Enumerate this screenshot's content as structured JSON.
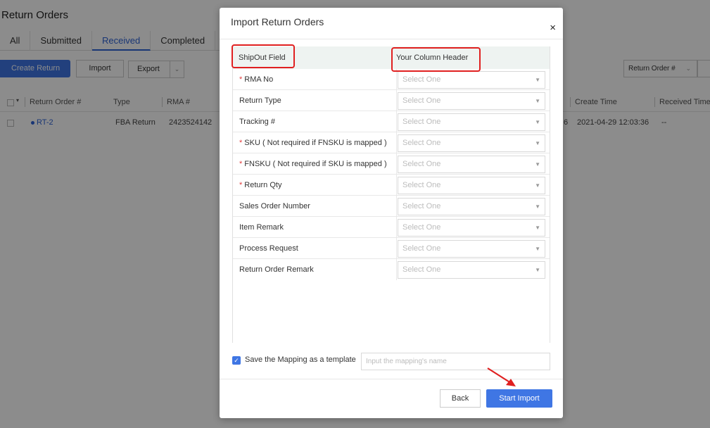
{
  "page": {
    "title": "Return Orders",
    "tabs": [
      "All",
      "Submitted",
      "Received",
      "Completed"
    ],
    "active_tab": "Received",
    "create_return": "Create Return",
    "import": "Import",
    "export": "Export",
    "filter_select": "Return Order #",
    "columns": [
      "Return Order #",
      "Type",
      "RMA #",
      "Create Time",
      "Received Time"
    ],
    "row": {
      "return_order": "RT-2",
      "type": "FBA Return",
      "rma": "2423524142",
      "partial_hidden": "6",
      "create_time": "2021-04-29 12:03:36",
      "received_time": "--"
    }
  },
  "modal": {
    "title": "Import Return Orders",
    "close_icon": "×",
    "header_field": "ShipOut Field",
    "header_column": "Your Column Header",
    "select_placeholder": "Select One",
    "fields": [
      {
        "label": "RMA No",
        "required": true
      },
      {
        "label": "Return Type",
        "required": false
      },
      {
        "label": "Tracking #",
        "required": false
      },
      {
        "label": "SKU ( Not required if FNSKU is mapped )",
        "required": true
      },
      {
        "label": "FNSKU ( Not required if SKU is mapped )",
        "required": true
      },
      {
        "label": "Return Qty",
        "required": true
      },
      {
        "label": "Sales Order Number",
        "required": false
      },
      {
        "label": "Item Remark",
        "required": false
      },
      {
        "label": "Process Request",
        "required": false
      },
      {
        "label": "Return Order Remark",
        "required": false
      }
    ],
    "save_template": {
      "checked": true,
      "label": "Save the Mapping as a template",
      "placeholder": "Input the mapping's name"
    },
    "back": "Back",
    "start_import": "Start Import"
  },
  "colors": {
    "primary": "#3f76e4",
    "annotation_red": "#e02020",
    "required_star": "#e23c3c"
  }
}
